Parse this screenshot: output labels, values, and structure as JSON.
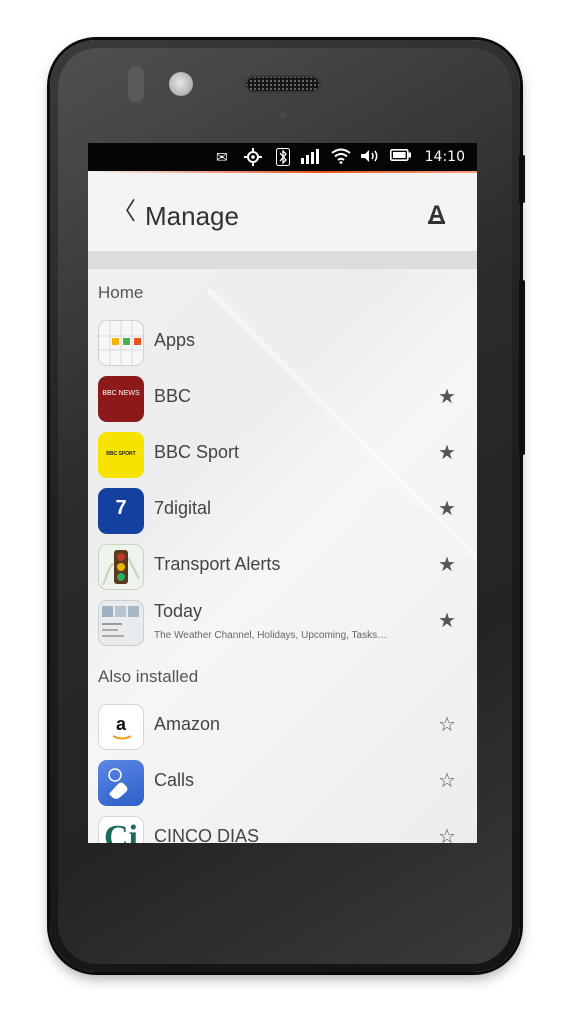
{
  "status_bar": {
    "icons": [
      "mail-icon",
      "location-icon",
      "bluetooth-icon",
      "signal-icon",
      "wifi-icon",
      "volume-icon",
      "battery-icon"
    ],
    "time": "14:10"
  },
  "header": {
    "title": "Manage",
    "back_icon": "chevron-left-icon",
    "store_icon": "store-icon"
  },
  "sections": {
    "home": "Home",
    "also_installed": "Also installed"
  },
  "home_items": [
    {
      "label": "Apps",
      "starred": null
    },
    {
      "label": "BBC",
      "starred": true
    },
    {
      "label": "BBC Sport",
      "starred": true
    },
    {
      "label": "7digital",
      "starred": true
    },
    {
      "label": "Transport Alerts",
      "starred": true
    },
    {
      "label": "Today",
      "sub": "The Weather Channel, Holidays, Upcoming, Tasks…",
      "starred": true
    }
  ],
  "installed_items": [
    {
      "label": "Amazon",
      "starred": false
    },
    {
      "label": "Calls",
      "starred": false
    },
    {
      "label": "CINCO DIAS",
      "starred": false
    }
  ],
  "icon_text": {
    "bbc": "BBC NEWS",
    "sport": "BBC SPORT",
    "sevendigital": "7",
    "amazon": "a",
    "cinco": "Ci"
  },
  "colors": {
    "accent": "#E95420",
    "bbc": "#8C1A1A",
    "bbc_sport": "#F7E300",
    "sevendigital": "#1440A0",
    "calls": "#3A6FD8"
  }
}
